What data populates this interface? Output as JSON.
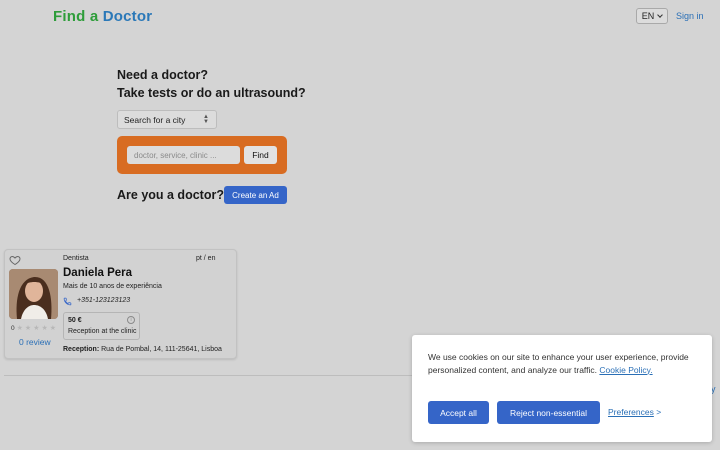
{
  "header": {
    "logo_part1": "Find a",
    "logo_part2": "Doctor",
    "lang": "EN",
    "sign_in": "Sign in",
    "logo_colors": [
      "#2e9d3a",
      "#2a78b8"
    ]
  },
  "hero": {
    "line1": "Need a doctor?",
    "line2": "Take tests or do an ultrasound?",
    "city_select": "Search for a city",
    "search_placeholder": "doctor, service, clinic ...",
    "find_label": "Find",
    "search_box_color": "#d86c22",
    "doctor_question": "Are you a doctor?",
    "create_ad_label": "Create an Ad"
  },
  "doctor_card": {
    "specialty": "Dentista",
    "languages": "pt / en",
    "name": "Daniela Pera",
    "experience": "Mais de 10 anos de experiência",
    "phone": "+351-123123123",
    "rating_value": "0",
    "rating_stars": 0,
    "reviews": "0 review",
    "price": "50 €",
    "reception_type": "Reception at the clinic",
    "reception_label": "Reception:",
    "address": "Rua de Pombal, 14, 111-25641, Lisboa"
  },
  "cookie_banner": {
    "text": "We use cookies on our site to enhance your user experience, provide personalized content, and analyze our traffic.",
    "policy_link": "Cookie Policy.",
    "accept_label": "Accept all",
    "reject_label": "Reject non-essential",
    "preferences_label": "Preferences",
    "preferences_arrow": ">",
    "button_color": "#3565c8"
  },
  "partial": {
    "text": "y"
  }
}
